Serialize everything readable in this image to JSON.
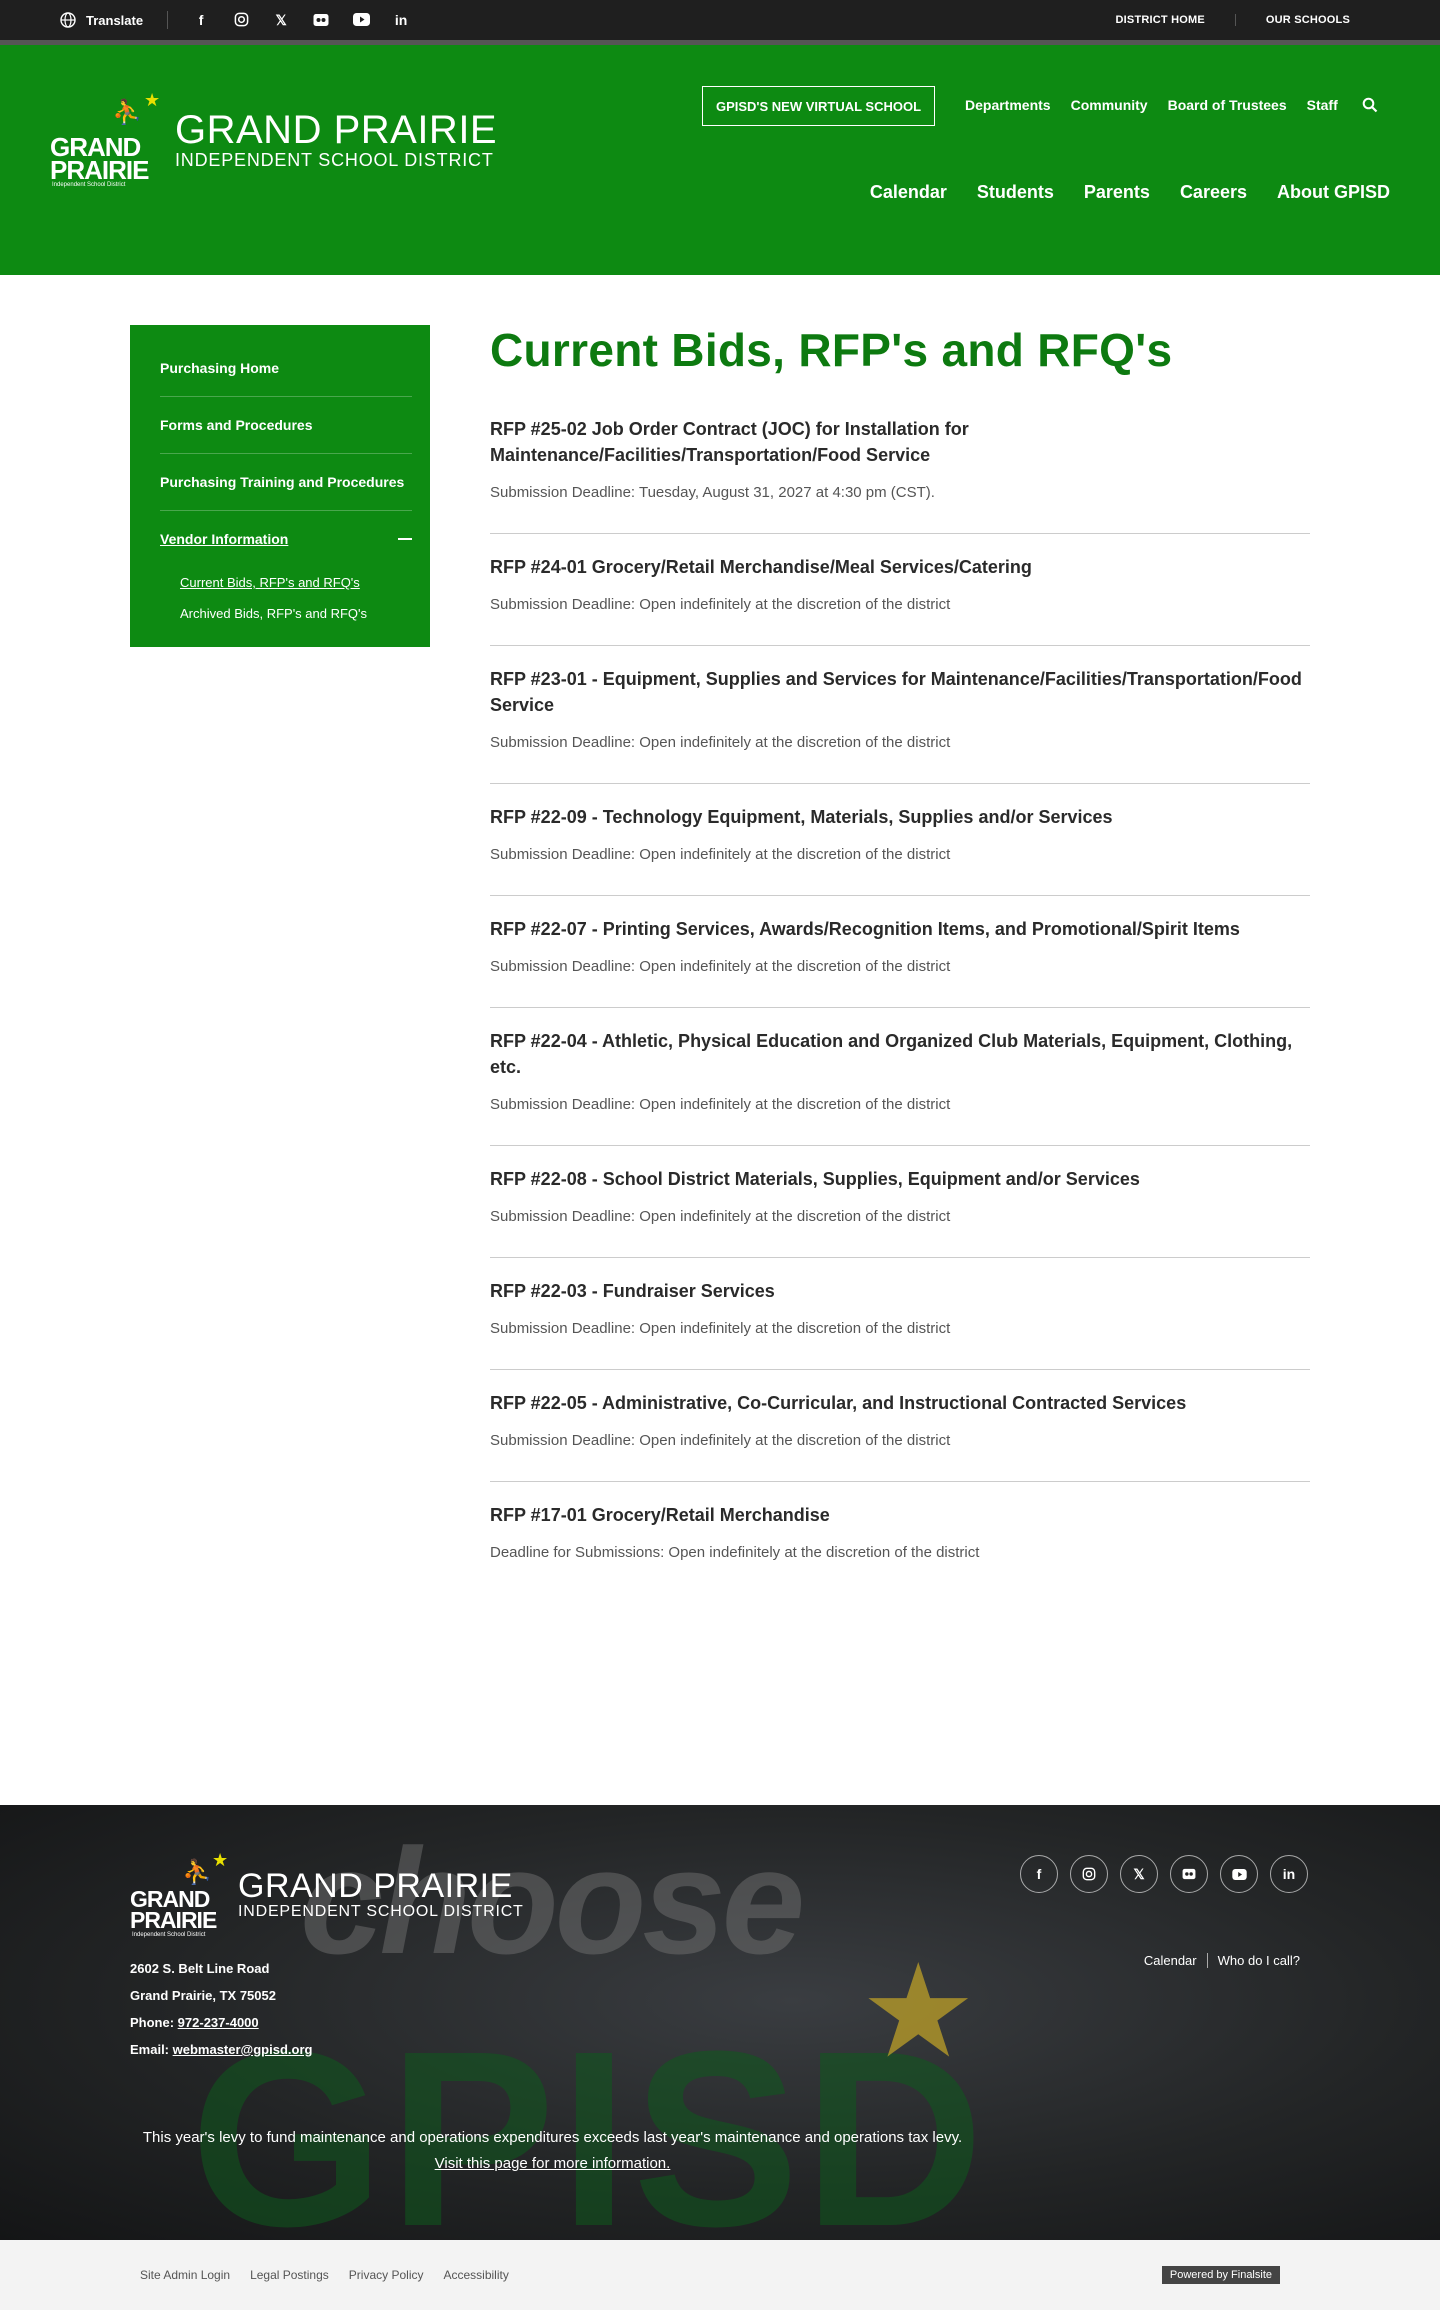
{
  "topbar": {
    "translate": "Translate",
    "social_icons": [
      "facebook-icon",
      "instagram-icon",
      "x-icon",
      "flickr-icon",
      "youtube-icon",
      "linkedin-icon"
    ],
    "district_home": "DISTRICT HOME",
    "our_schools": "OUR SCHOOLS"
  },
  "header": {
    "logo_line1": "GRAND PRAIRIE",
    "logo_line2": "INDEPENDENT SCHOOL DISTRICT",
    "logo_mark_text1": "GRAND",
    "logo_mark_text2": "PRAIRIE",
    "logo_mark_text3": "Independent School District",
    "virtual_school": "GPISD'S NEW VIRTUAL SCHOOL",
    "util_nav": [
      "Departments",
      "Community",
      "Board of Trustees",
      "Staff"
    ],
    "main_nav": [
      "Calendar",
      "Students",
      "Parents",
      "Careers",
      "About GPISD"
    ]
  },
  "sidebar": {
    "items": [
      "Purchasing Home",
      "Forms and Procedures",
      "Purchasing Training and Procedures",
      "Vendor Information"
    ],
    "sub_items": [
      "Current Bids, RFP's and RFQ's",
      "Archived Bids, RFP's and RFQ's"
    ]
  },
  "main": {
    "title": "Current Bids, RFP's and RFQ's",
    "bids": [
      {
        "title": "RFP #25-02 Job Order Contract (JOC) for Installation for Maintenance/Facilities/Transportation/Food Service",
        "deadline": "Submission Deadline: Tuesday, August 31, 2027 at 4:30 pm (CST)."
      },
      {
        "title": "RFP #24-01 Grocery/Retail Merchandise/Meal Services/Catering",
        "deadline": "Submission Deadline: Open indefinitely at the discretion of the district"
      },
      {
        "title": "RFP #23-01 - Equipment, Supplies and Services for Maintenance/Facilities/Transportation/Food Service",
        "deadline": "Submission Deadline: Open indefinitely at the discretion of the district"
      },
      {
        "title": "RFP #22-09 - Technology Equipment, Materials, Supplies and/or Services",
        "deadline": "Submission Deadline: Open indefinitely at the discretion of the district"
      },
      {
        "title": "RFP #22-07 - Printing Services, Awards/Recognition Items, and Promotional/Spirit Items",
        "deadline": "Submission Deadline: Open indefinitely at the discretion of the district"
      },
      {
        "title": "RFP #22-04 - Athletic, Physical Education and Organized Club Materials, Equipment, Clothing, etc.",
        "deadline": "Submission Deadline: Open indefinitely at the discretion of the district"
      },
      {
        "title": "RFP #22-08 - School District Materials, Supplies, Equipment and/or Services",
        "deadline": "Submission Deadline: Open indefinitely at the discretion of the district"
      },
      {
        "title": "RFP #22-03 - Fundraiser Services",
        "deadline": "Submission Deadline: Open indefinitely at the discretion of the district"
      },
      {
        "title": "RFP #22-05 - Administrative, Co-Curricular, and Instructional Contracted Services",
        "deadline": "Submission Deadline: Open indefinitely at the discretion of the district"
      },
      {
        "title": "RFP #17-01 Grocery/Retail Merchandise",
        "deadline": "Deadline for Submissions: Open indefinitely at the discretion of the district"
      }
    ]
  },
  "footer": {
    "address1": "2602 S. Belt Line Road",
    "address2": "Grand Prairie,  TX   75052",
    "phone_label": "Phone: ",
    "phone": "972-237-4000",
    "email_label": "Email: ",
    "email": "webmaster@gpisd.org",
    "links": [
      "Calendar",
      "Who do I call?"
    ],
    "levy_text": "This year's levy to fund maintenance and operations expenditures exceeds last year's maintenance and operations tax levy.",
    "levy_link": "Visit this page for more information.",
    "bg_word1": "choose",
    "bg_word2": "GPISD"
  },
  "bottom": {
    "links": [
      "Site Admin Login",
      "Legal Postings",
      "Privacy Policy",
      "Accessibility"
    ],
    "powered": "Powered by Finalsite"
  }
}
